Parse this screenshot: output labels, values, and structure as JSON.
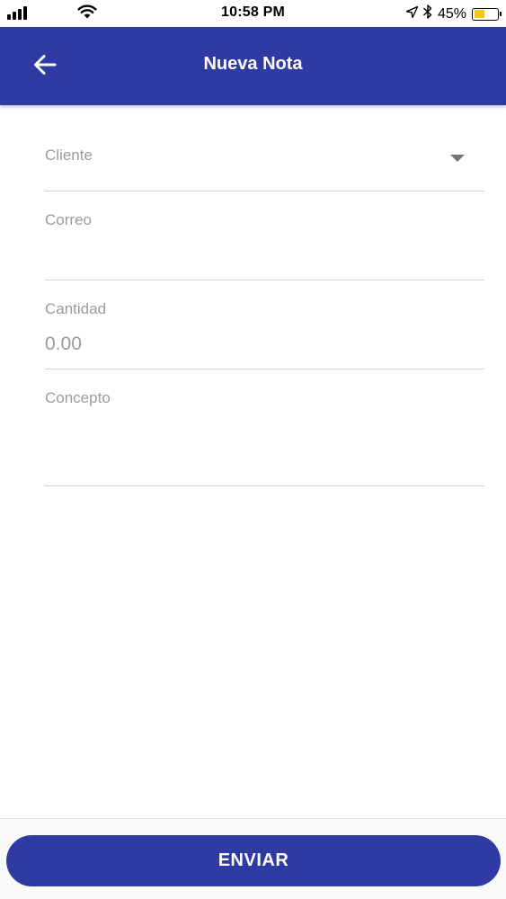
{
  "status_bar": {
    "time": "10:58 PM",
    "battery_percent": "45%",
    "battery_level": 0.45,
    "icons": [
      "signal-icon",
      "wifi-icon",
      "location-arrow-icon",
      "bluetooth-icon",
      "battery-icon"
    ],
    "battery_color": "#f5c518"
  },
  "app_bar": {
    "title": "Nueva Nota",
    "back_icon": "arrow-left-icon",
    "background_color": "#2f3ba3"
  },
  "form": {
    "cliente": {
      "label": "Cliente",
      "value": "",
      "icon": "caret-down-icon"
    },
    "correo": {
      "label": "Correo",
      "value": ""
    },
    "cantidad": {
      "label": "Cantidad",
      "value": "",
      "placeholder": "0.00"
    },
    "concepto": {
      "label": "Concepto",
      "value": ""
    }
  },
  "footer": {
    "send_label": "ENVIAR",
    "button_color": "#2f3ba3"
  }
}
